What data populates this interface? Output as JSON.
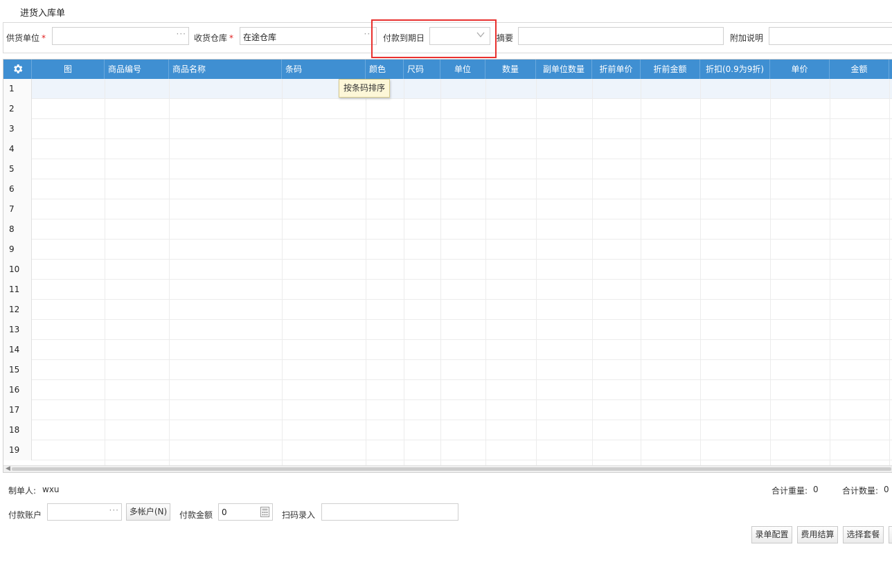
{
  "title": "进货入库单",
  "form": {
    "supplier_label": "供货单位",
    "supplier_required": "*",
    "supplier_value": "",
    "warehouse_label": "收货仓库",
    "warehouse_required": "*",
    "warehouse_value": "在途仓库",
    "due_date_label": "付款到期日",
    "due_date_value": "",
    "summary_label": "摘要",
    "summary_value": "",
    "note_label": "附加说明",
    "note_value": ""
  },
  "grid": {
    "columns": [
      "图",
      "商品编号",
      "商品名称",
      "条码",
      "颜色",
      "尺码",
      "单位",
      "数量",
      "副单位数量",
      "折前单价",
      "折前金额",
      "折扣(0.9为9折)",
      "单价",
      "金额"
    ],
    "rows": [
      "1",
      "2",
      "3",
      "4",
      "5",
      "6",
      "7",
      "8",
      "9",
      "10",
      "11",
      "12",
      "13",
      "14",
      "15",
      "16",
      "17",
      "18",
      "19"
    ],
    "tooltip": "按条码排序"
  },
  "footer": {
    "creator_label": "制单人:",
    "creator_value": "wxu",
    "total_weight_label": "合计重量:",
    "total_weight_value": "0",
    "total_qty_label": "合计数量:",
    "total_qty_value": "0",
    "pay_account_label": "付款账户",
    "pay_account_value": "",
    "multi_account_button": "多帐户(N)",
    "pay_amount_label": "付款金额",
    "pay_amount_value": "0",
    "scan_label": "扫码录入",
    "scan_value": "",
    "buttons": [
      "录单配置",
      "费用结算",
      "选择套餐"
    ]
  },
  "colors": {
    "header_bg": "#3f8fd2",
    "highlight_border": "#e8302e",
    "required": "#e02020",
    "tooltip_bg": "#fdf7d8"
  }
}
